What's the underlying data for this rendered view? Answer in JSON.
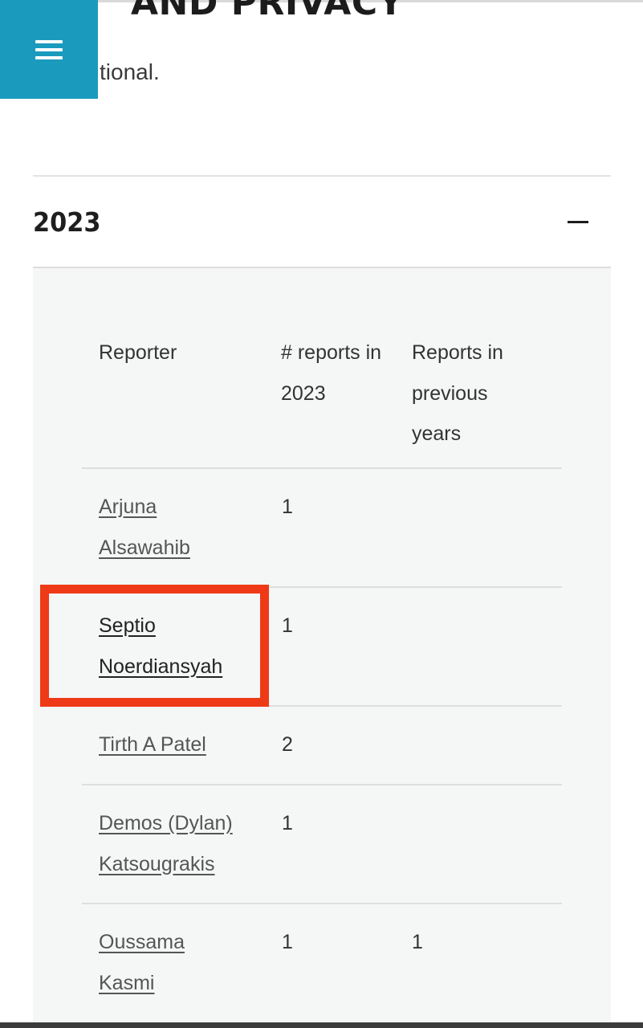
{
  "page": {
    "heading_partial": "AND PRIVACY",
    "intro_partial": "tional."
  },
  "menu": {
    "icon": "hamburger-menu-icon"
  },
  "accordion": {
    "year": "2023",
    "state_icon": "minus-icon"
  },
  "table": {
    "headers": {
      "reporter": "Reporter",
      "reports_year": "# reports in 2023",
      "reports_previous": "Reports in previous years"
    },
    "rows": [
      {
        "name": "Arjuna Alsawahib",
        "count": "1",
        "previous": ""
      },
      {
        "name": "Septio Noerdiansyah",
        "count": "1",
        "previous": ""
      },
      {
        "name": "Tirth A Patel",
        "count": "2",
        "previous": ""
      },
      {
        "name": "Demos (Dylan) Katsougrakis",
        "count": "1",
        "previous": ""
      },
      {
        "name": "Oussama Kasmi",
        "count": "1",
        "previous": "1"
      }
    ]
  },
  "annotation": {
    "highlight_color": "#ee3a17",
    "highlighted_reporter": "Septio Noerdiansyah"
  },
  "colors": {
    "menu_bg": "#1a9bbd",
    "panel_bg": "#f5f6f6"
  }
}
